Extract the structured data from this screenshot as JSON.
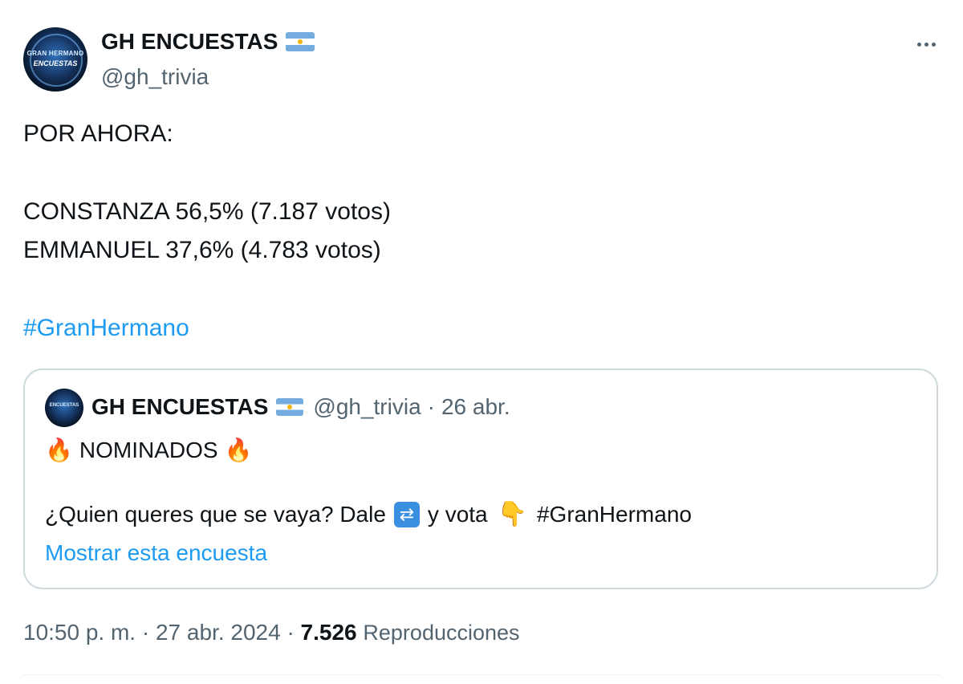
{
  "author": {
    "display_name": "GH ENCUESTAS",
    "handle": "@gh_trivia",
    "avatar_text_top": "GRAN HERMANO",
    "avatar_text_bottom": "ENCUESTAS",
    "flag_icon": "argentina-flag-icon"
  },
  "post": {
    "line1": "POR AHORA:",
    "line2": "CONSTANZA 56,5% (7.187 votos)",
    "line3": "EMMANUEL 37,6% (4.783 votos)",
    "hashtag": "#GranHermano"
  },
  "quoted": {
    "display_name": "GH ENCUESTAS",
    "handle": "@gh_trivia",
    "separator": "·",
    "date": "26 abr.",
    "line1": "NOMINADOS",
    "line2_a": "¿Quien queres que se vaya? Dale",
    "line2_b": "y vota",
    "line2_hashtag": "#GranHermano",
    "show_poll_link": "Mostrar esta encuesta"
  },
  "footer": {
    "timestamp": "10:50 p. m. · 27 abr. 2024 ·",
    "views_count": "7.526",
    "views_label": "Reproducciones"
  },
  "colors": {
    "link": "#1d9bf0",
    "text": "#0f1419",
    "muted": "#536471",
    "border": "#cfd9de"
  }
}
